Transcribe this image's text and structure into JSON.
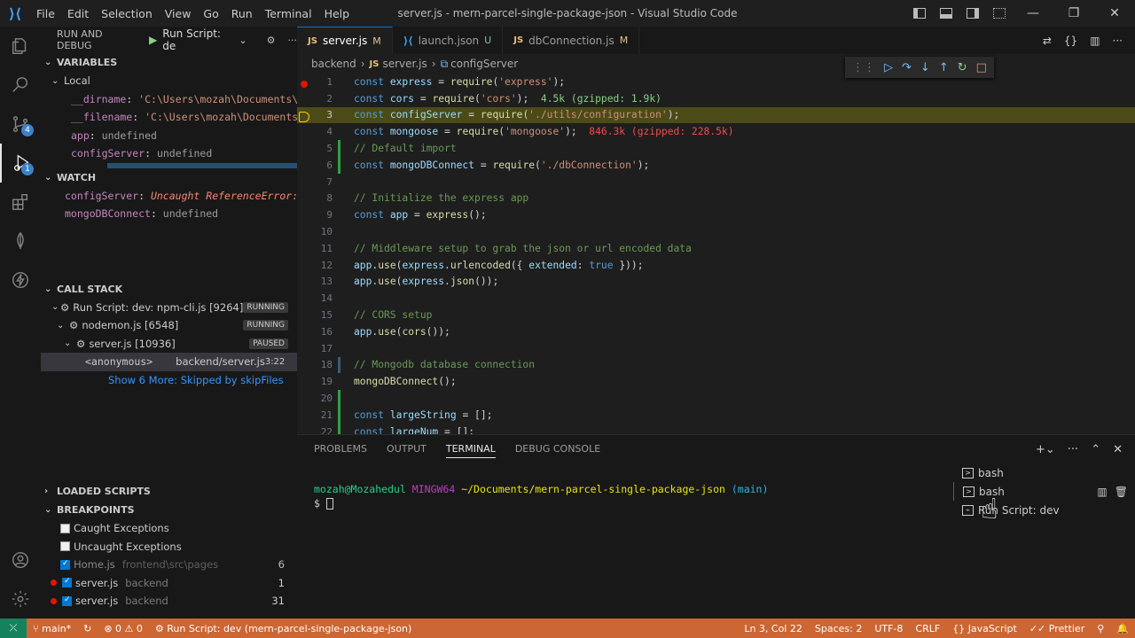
{
  "window": {
    "title": "server.js - mern-parcel-single-package-json - Visual Studio Code",
    "menu": [
      "File",
      "Edit",
      "Selection",
      "View",
      "Go",
      "Run",
      "Terminal",
      "Help"
    ]
  },
  "activity": {
    "scm_badge": "4",
    "debug_badge": "1"
  },
  "sidebar": {
    "header": "RUN AND DEBUG",
    "config": "Run Script: de",
    "variables_title": "VARIABLES",
    "local_title": "Local",
    "variables": [
      {
        "name": "__dirname",
        "value": "'C:\\Users\\mozah\\Documents\\…"
      },
      {
        "name": "__filename",
        "value": "'C:\\Users\\mozah\\Documents…"
      },
      {
        "name": "app",
        "value": "undefined"
      },
      {
        "name": "configServer",
        "value": "undefined"
      }
    ],
    "watch_title": "WATCH",
    "watch": [
      {
        "name": "configServer",
        "value": "Uncaught ReferenceError:…"
      },
      {
        "name": "mongoDBConnect",
        "value": "undefined"
      }
    ],
    "callstack_title": "CALL STACK",
    "callstack": [
      {
        "label": "Run Script: dev: npm-cli.js [9264]",
        "state": "RUNNING"
      },
      {
        "label": "nodemon.js [6548]",
        "state": "RUNNING"
      },
      {
        "label": "server.js [10936]",
        "state": "PAUSED"
      }
    ],
    "frame": {
      "name": "<anonymous>",
      "file": "backend/server.js",
      "pos": "3:22"
    },
    "skipped": "Show 6 More: Skipped by skipFiles",
    "loaded_title": "LOADED SCRIPTS",
    "breakpoints_title": "BREAKPOINTS",
    "breakpoints": [
      {
        "label": "Caught Exceptions",
        "dir": "",
        "count": "",
        "checked": false,
        "dot": false
      },
      {
        "label": "Uncaught Exceptions",
        "dir": "",
        "count": "",
        "checked": false,
        "dot": false
      },
      {
        "label": "Home.js",
        "dir": "frontend\\src\\pages",
        "count": "6",
        "checked": true,
        "dot": false
      },
      {
        "label": "server.js",
        "dir": "backend",
        "count": "1",
        "checked": true,
        "dot": true
      },
      {
        "label": "server.js",
        "dir": "backend",
        "count": "31",
        "checked": true,
        "dot": true
      }
    ]
  },
  "tabs": [
    {
      "icon": "JS",
      "label": "server.js",
      "status": "M"
    },
    {
      "icon": "{}",
      "label": "launch.json",
      "status": "U"
    },
    {
      "icon": "JS",
      "label": "dbConnection.js",
      "status": "M"
    }
  ],
  "breadcrumb": [
    "backend",
    "server.js",
    "configServer"
  ],
  "code": {
    "l1": "const express = require('express');",
    "l2_size": "4.5k (gzipped: 1.9k)",
    "l4_size": "846.3k (gzipped: 228.5k)",
    "l5": "// Default import",
    "l8": "// Initialize the express app",
    "l11": "// Middleware setup to grab the json or url encoded data",
    "l15": "// CORS setup",
    "l18": "// Mongodb database connection"
  },
  "panel": {
    "tabs": [
      "PROBLEMS",
      "OUTPUT",
      "TERMINAL",
      "DEBUG CONSOLE"
    ],
    "prompt_user": "mozah@Mozahedul",
    "prompt_host": "MINGW64",
    "prompt_path": "~/Documents/mern-parcel-single-package-json",
    "prompt_branch": "(main)",
    "prompt_char": "$",
    "terminals": [
      "bash",
      "bash",
      "Run Script: dev"
    ]
  },
  "status": {
    "branch": "main*",
    "errors": "0",
    "warnings": "0",
    "debug_session": "Run Script: dev (mern-parcel-single-package-json)",
    "position": "Ln 3, Col 22",
    "spaces": "Spaces: 2",
    "encoding": "UTF-8",
    "eol": "CRLF",
    "language": "JavaScript",
    "prettier": "Prettier"
  },
  "colors": {
    "statusbar": "#cc6633",
    "accent": "#0078d4"
  }
}
